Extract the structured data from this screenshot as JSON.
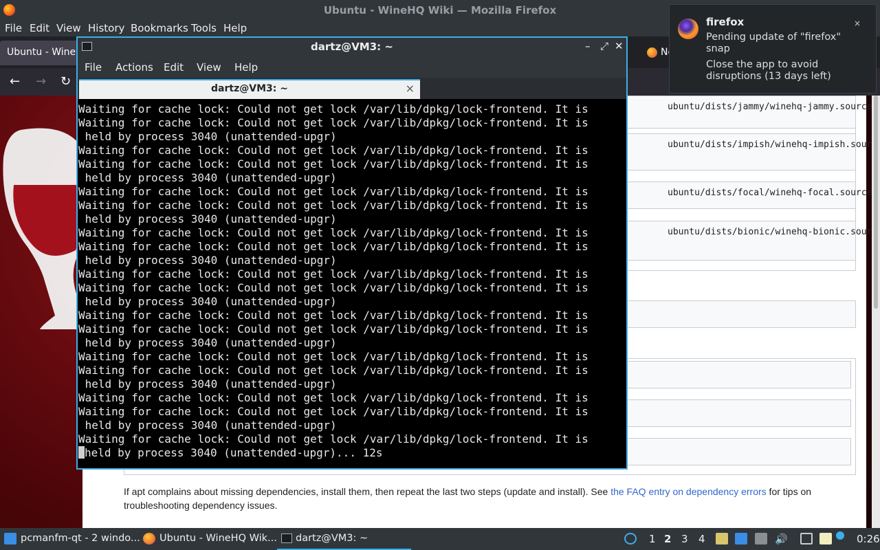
{
  "firefox": {
    "window_title": "Ubuntu - WineHQ Wiki — Mozilla Firefox",
    "menu": [
      "File",
      "Edit",
      "View",
      "History",
      "Bookmarks",
      "Tools",
      "Help"
    ],
    "tabs": [
      {
        "label": "Ubuntu - WineH"
      },
      {
        "label": "Ne"
      }
    ],
    "page": {
      "url_lines": [
        "ubuntu/dists/jammy/winehq-jammy.sources",
        "ubuntu/dists/impish/winehq-impish.sourc",
        "ubuntu/dists/focal/winehq-focal.sources",
        "ubuntu/dists/bionic/winehq-bionic.sourc"
      ],
      "footer_before": "If apt complains about missing dependencies, install them, then repeat the last two steps (update and install). See ",
      "footer_link": "the FAQ entry on dependency errors",
      "footer_after": " for tips on troubleshooting dependency issues."
    }
  },
  "terminal": {
    "title": "dartz@VM3: ~",
    "menu": [
      "File",
      "Actions",
      "Edit",
      "View",
      "Help"
    ],
    "tab_label": "dartz@VM3: ~",
    "lines": [
      "Waiting for cache lock: Could not get lock /var/lib/dpkg/lock-frontend. It is",
      "Waiting for cache lock: Could not get lock /var/lib/dpkg/lock-frontend. It is",
      " held by process 3040 (unattended-upgr)",
      "Waiting for cache lock: Could not get lock /var/lib/dpkg/lock-frontend. It is",
      "Waiting for cache lock: Could not get lock /var/lib/dpkg/lock-frontend. It is",
      " held by process 3040 (unattended-upgr)",
      "Waiting for cache lock: Could not get lock /var/lib/dpkg/lock-frontend. It is",
      "Waiting for cache lock: Could not get lock /var/lib/dpkg/lock-frontend. It is",
      " held by process 3040 (unattended-upgr)",
      "Waiting for cache lock: Could not get lock /var/lib/dpkg/lock-frontend. It is",
      "Waiting for cache lock: Could not get lock /var/lib/dpkg/lock-frontend. It is",
      " held by process 3040 (unattended-upgr)",
      "Waiting for cache lock: Could not get lock /var/lib/dpkg/lock-frontend. It is",
      "Waiting for cache lock: Could not get lock /var/lib/dpkg/lock-frontend. It is",
      " held by process 3040 (unattended-upgr)",
      "Waiting for cache lock: Could not get lock /var/lib/dpkg/lock-frontend. It is",
      "Waiting for cache lock: Could not get lock /var/lib/dpkg/lock-frontend. It is",
      " held by process 3040 (unattended-upgr)",
      "Waiting for cache lock: Could not get lock /var/lib/dpkg/lock-frontend. It is",
      "Waiting for cache lock: Could not get lock /var/lib/dpkg/lock-frontend. It is",
      " held by process 3040 (unattended-upgr)",
      "Waiting for cache lock: Could not get lock /var/lib/dpkg/lock-frontend. It is",
      "Waiting for cache lock: Could not get lock /var/lib/dpkg/lock-frontend. It is",
      " held by process 3040 (unattended-upgr)",
      "Waiting for cache lock: Could not get lock /var/lib/dpkg/lock-frontend. It is"
    ],
    "last_line": "held by process 3040 (unattended-upgr)... 12s"
  },
  "notification": {
    "app": "firefox",
    "line1": "Pending update of \"firefox\" snap",
    "line2": "Close the app to avoid disruptions (13 days left)",
    "close": "×"
  },
  "taskbar": {
    "tasks": [
      {
        "label": "pcmanfm-qt - 2 windo..."
      },
      {
        "label": "Ubuntu - WineHQ Wik..."
      },
      {
        "label": "dartz@VM3: ~"
      }
    ],
    "workspaces": [
      "1",
      "2",
      "3",
      "4"
    ],
    "active_workspace": "2",
    "clock": "0:26"
  }
}
